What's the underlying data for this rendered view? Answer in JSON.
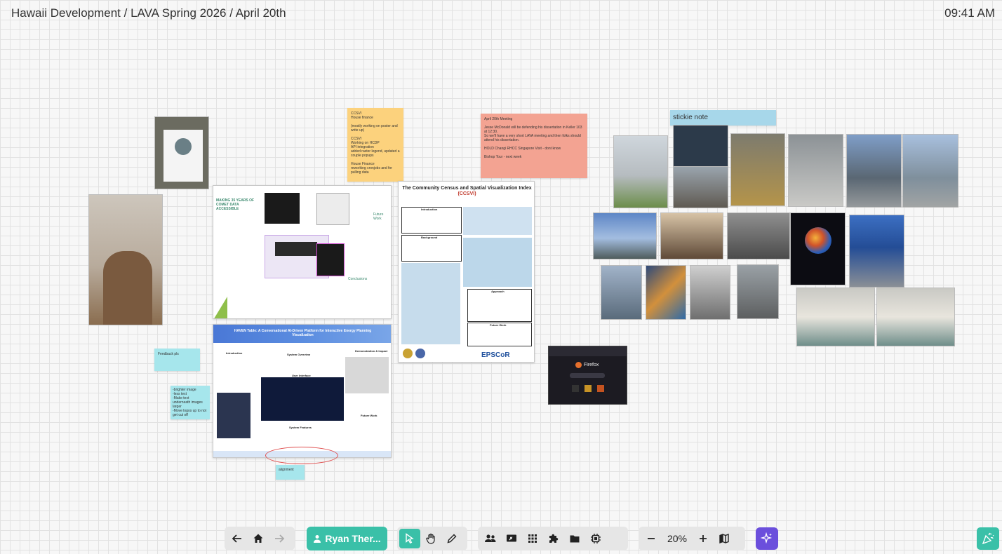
{
  "header": {
    "breadcrumb": "Hawaii Development / LAVA Spring 2026 / April 20th",
    "time": "09:41 AM"
  },
  "notes": {
    "ccsvi_status": "CCSVI\nHouse finance\n\n(mostly working on poster and write up)\n\nCCSVI\nWorking on HCDP\nAPI integration\nadded raster legend, updated a couple popups\n\nHouse Finance\nreworking cronjobs and for pulling data",
    "meeting": "April 20th Meeting\n\nJesse McDonald will be defending his dissertation in Keller 103 at 12:30.\nSo we'll have a very short LAVA meeting and then folks should attend his dissertation.\n\nHOLD Changi RHCC Singapore Visit - dont know\n\nBishop Tour - next week",
    "stickie": "stickie note",
    "feedback": "Feedback pls",
    "improvements": "-brighter image\n-less text\n-Make text underneath images larger\n-Move logos up to not get cut off",
    "alignment": "alignment"
  },
  "posters": {
    "comet": {
      "title": "MAKING 35 YEARS OF COMET DATA ACCESSIBLE",
      "future_work": "Future Work",
      "conclusions": "Conclusions"
    },
    "haven": {
      "title": "HAVEN Table: A Conversational AI-Driven Platform for Interactive Energy Planning Visualization",
      "introduction": "Introduction",
      "system_overview": "System Overview",
      "demonstration": "Demonstration & Impact",
      "user_interface": "User Interface",
      "system_features": "System Features",
      "future_work": "Future Work"
    },
    "ccsvi": {
      "title_main": "The Community Census and Spatial Visualization Index",
      "title_abbr": "(CCSVI)",
      "introduction": "Introduction",
      "background": "Background",
      "approach": "Approach",
      "future_work": "Future Work",
      "sponsor": "EPSCoR"
    },
    "browser": {
      "app_name": "Firefox"
    }
  },
  "toolbar": {
    "user_name": "Ryan Ther...",
    "zoom": "20%"
  },
  "icons": {
    "back": "arrow-left-icon",
    "home": "home-icon",
    "forward": "arrow-right-icon",
    "user": "user-icon",
    "select": "cursor-icon",
    "pan": "hand-icon",
    "pen": "pencil-icon",
    "people": "people-icon",
    "share": "screen-share-icon",
    "apps": "grid-icon",
    "plugins": "puzzle-icon",
    "files": "folder-icon",
    "chip": "chip-icon",
    "zoom_out": "minus-icon",
    "zoom_in": "plus-icon",
    "map": "map-icon",
    "ai": "sparkle-icon",
    "celebrate": "party-popper-icon"
  },
  "colors": {
    "accent": "#3ac0a8",
    "ai_button": "#6b4fdc",
    "sticky_yellow": "#fcd27d",
    "sticky_salmon": "#f3a392",
    "sticky_cyan": "#a6e6ec",
    "sticky_blue": "#a7d7ea"
  }
}
